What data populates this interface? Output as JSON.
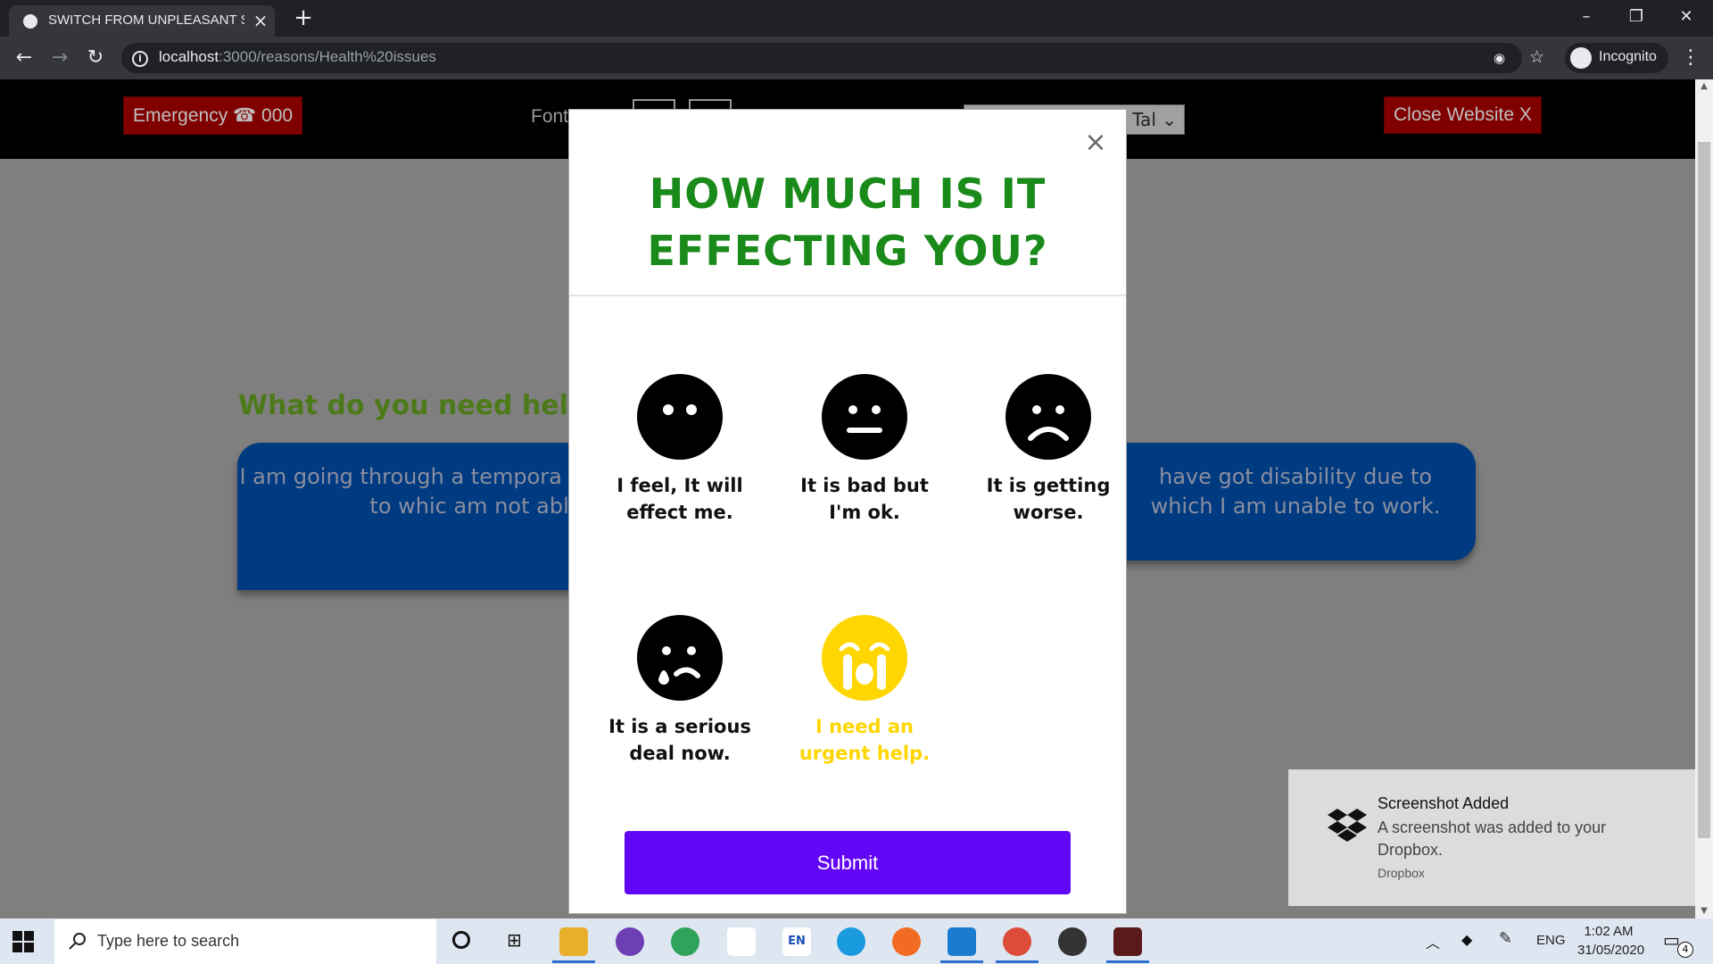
{
  "browser": {
    "tab_title": "SWITCH FROM UNPLEASANT SC",
    "url_host": "localhost",
    "url_path": ":3000/reasons/Health%20issues",
    "profile_label": "Incognito"
  },
  "site_header": {
    "emergency_label": "Emergency ☎ 000",
    "font_label": "Font",
    "language_value": ", Tal ⌄",
    "close_label": "Close Website X"
  },
  "page": {
    "heading": "What do you need help",
    "card_left_text": "I am going through a tempora medical condition due to whic am not able to work.",
    "card_right_text": "have got disability due to which I am unable to work."
  },
  "modal": {
    "close_glyph": "×",
    "title_line1": "HOW MUCH IS IT",
    "title_line2": "EFFECTING YOU?",
    "options": [
      {
        "line1": "I feel, It will",
        "line2": "effect me.",
        "icon": "neutral-face-icon"
      },
      {
        "line1": "It is bad but",
        "line2": "I'm ok.",
        "icon": "expressionless-face-icon"
      },
      {
        "line1": "It is getting",
        "line2": "worse.",
        "icon": "frowning-face-icon"
      },
      {
        "line1": "It is a serious",
        "line2": "deal now.",
        "icon": "sad-tear-face-icon"
      },
      {
        "line1": "I need an",
        "line2": "urgent help.",
        "icon": "crying-face-icon"
      }
    ],
    "selected_color": "#ffd600",
    "submit_label": "Submit",
    "submit_color": "#6207f5"
  },
  "toast": {
    "title": "Screenshot Added",
    "body": "A screenshot was added to your Dropbox.",
    "source": "Dropbox"
  },
  "taskbar": {
    "search_placeholder": "Type here to search",
    "language": "ENG",
    "time": "1:02 AM",
    "date": "31/05/2020",
    "notification_count": "4"
  }
}
